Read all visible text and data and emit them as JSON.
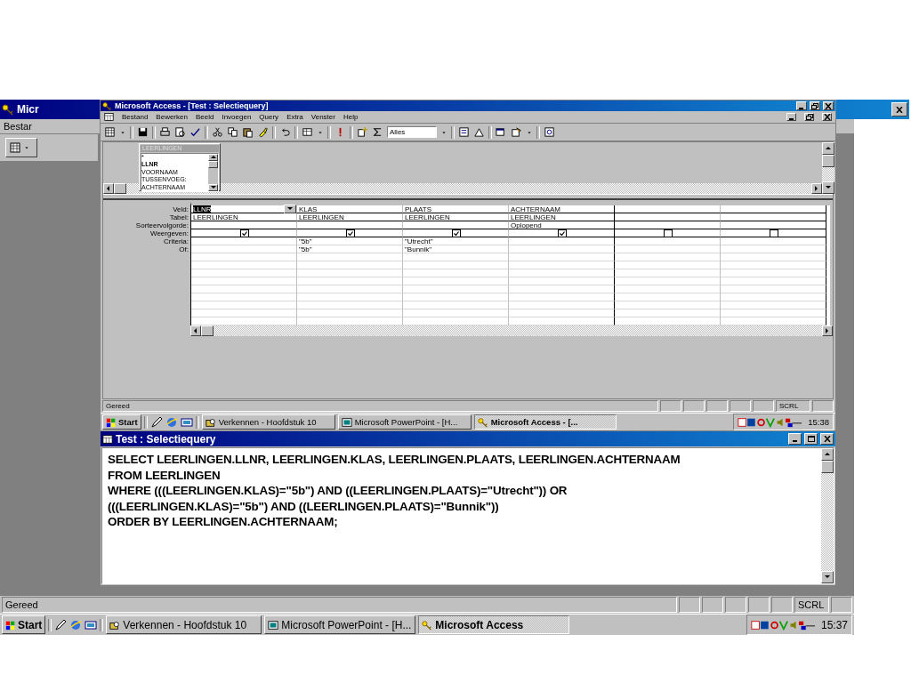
{
  "outer_window": {
    "title": "Micr",
    "menu": [
      "Bestar"
    ],
    "status_bar": {
      "text": "Gereed",
      "indicators": [
        "SCRL"
      ]
    },
    "taskbar": {
      "start": "Start",
      "tasks": [
        {
          "label": "Verkennen - Hoofdstuk 10",
          "selected": false
        },
        {
          "label": "Microsoft PowerPoint - [H...",
          "selected": false
        },
        {
          "label": "Microsoft Access",
          "selected": true
        }
      ],
      "clock": "15:37"
    }
  },
  "access_window": {
    "title": "Microsoft Access - [Test : Selectiequery]",
    "menu": [
      "Bestand",
      "Bewerken",
      "Beeld",
      "Invoegen",
      "Query",
      "Extra",
      "Venster",
      "Help"
    ],
    "toolbar": {
      "combo": "Alles"
    },
    "field_list": {
      "title": "LEERLINGEN",
      "fields": [
        {
          "name": "*",
          "primary_key": false
        },
        {
          "name": "LLNR",
          "primary_key": true
        },
        {
          "name": "VOORNAAM",
          "primary_key": false
        },
        {
          "name": "TUSSENVOEG:",
          "primary_key": false
        },
        {
          "name": "ACHTERNAAM",
          "primary_key": false
        }
      ]
    },
    "grid": {
      "row_labels": [
        "Veld:",
        "Tabel:",
        "Sorteervolgorde:",
        "Weergeven:",
        "Criteria:",
        "Of:"
      ],
      "columns": [
        {
          "field": "LLNR",
          "table": "LEERLINGEN",
          "show": true,
          "selected": true
        },
        {
          "field": "KLAS",
          "table": "LEERLINGEN",
          "show": true,
          "criteria": "\"5b\"",
          "or": "\"5b\"",
          "selected": false
        },
        {
          "field": "PLAATS",
          "table": "LEERLINGEN",
          "show": true,
          "criteria": "\"Utrecht\"",
          "or": "\"Bunnik\"",
          "selected": false
        },
        {
          "field": "ACHTERNAAM",
          "table": "LEERLINGEN",
          "sort": "Oplopend",
          "show": true,
          "selected": false
        },
        {
          "show": false,
          "selected": false
        },
        {
          "show": false,
          "selected": false
        }
      ]
    },
    "status_bar": {
      "text": "Gereed",
      "indicators": [
        "SCRL"
      ]
    },
    "taskbar": {
      "start": "Start",
      "tasks": [
        {
          "label": "Verkennen - Hoofdstuk 10",
          "selected": false
        },
        {
          "label": "Microsoft PowerPoint - [H...",
          "selected": false
        },
        {
          "label": "Microsoft Access - [...",
          "selected": true
        }
      ],
      "clock": "15:38"
    }
  },
  "sql_window": {
    "title": "Test : Selectiequery",
    "lines": [
      "SELECT LEERLINGEN.LLNR, LEERLINGEN.KLAS, LEERLINGEN.PLAATS, LEERLINGEN.ACHTERNAAM",
      "FROM LEERLINGEN",
      "WHERE (((LEERLINGEN.KLAS)=\"5b\") AND ((LEERLINGEN.PLAATS)=\"Utrecht\")) OR",
      "(((LEERLINGEN.KLAS)=\"5b\") AND ((LEERLINGEN.PLAATS)=\"Bunnik\"))",
      "ORDER BY LEERLINGEN.ACHTERNAAM;"
    ]
  }
}
